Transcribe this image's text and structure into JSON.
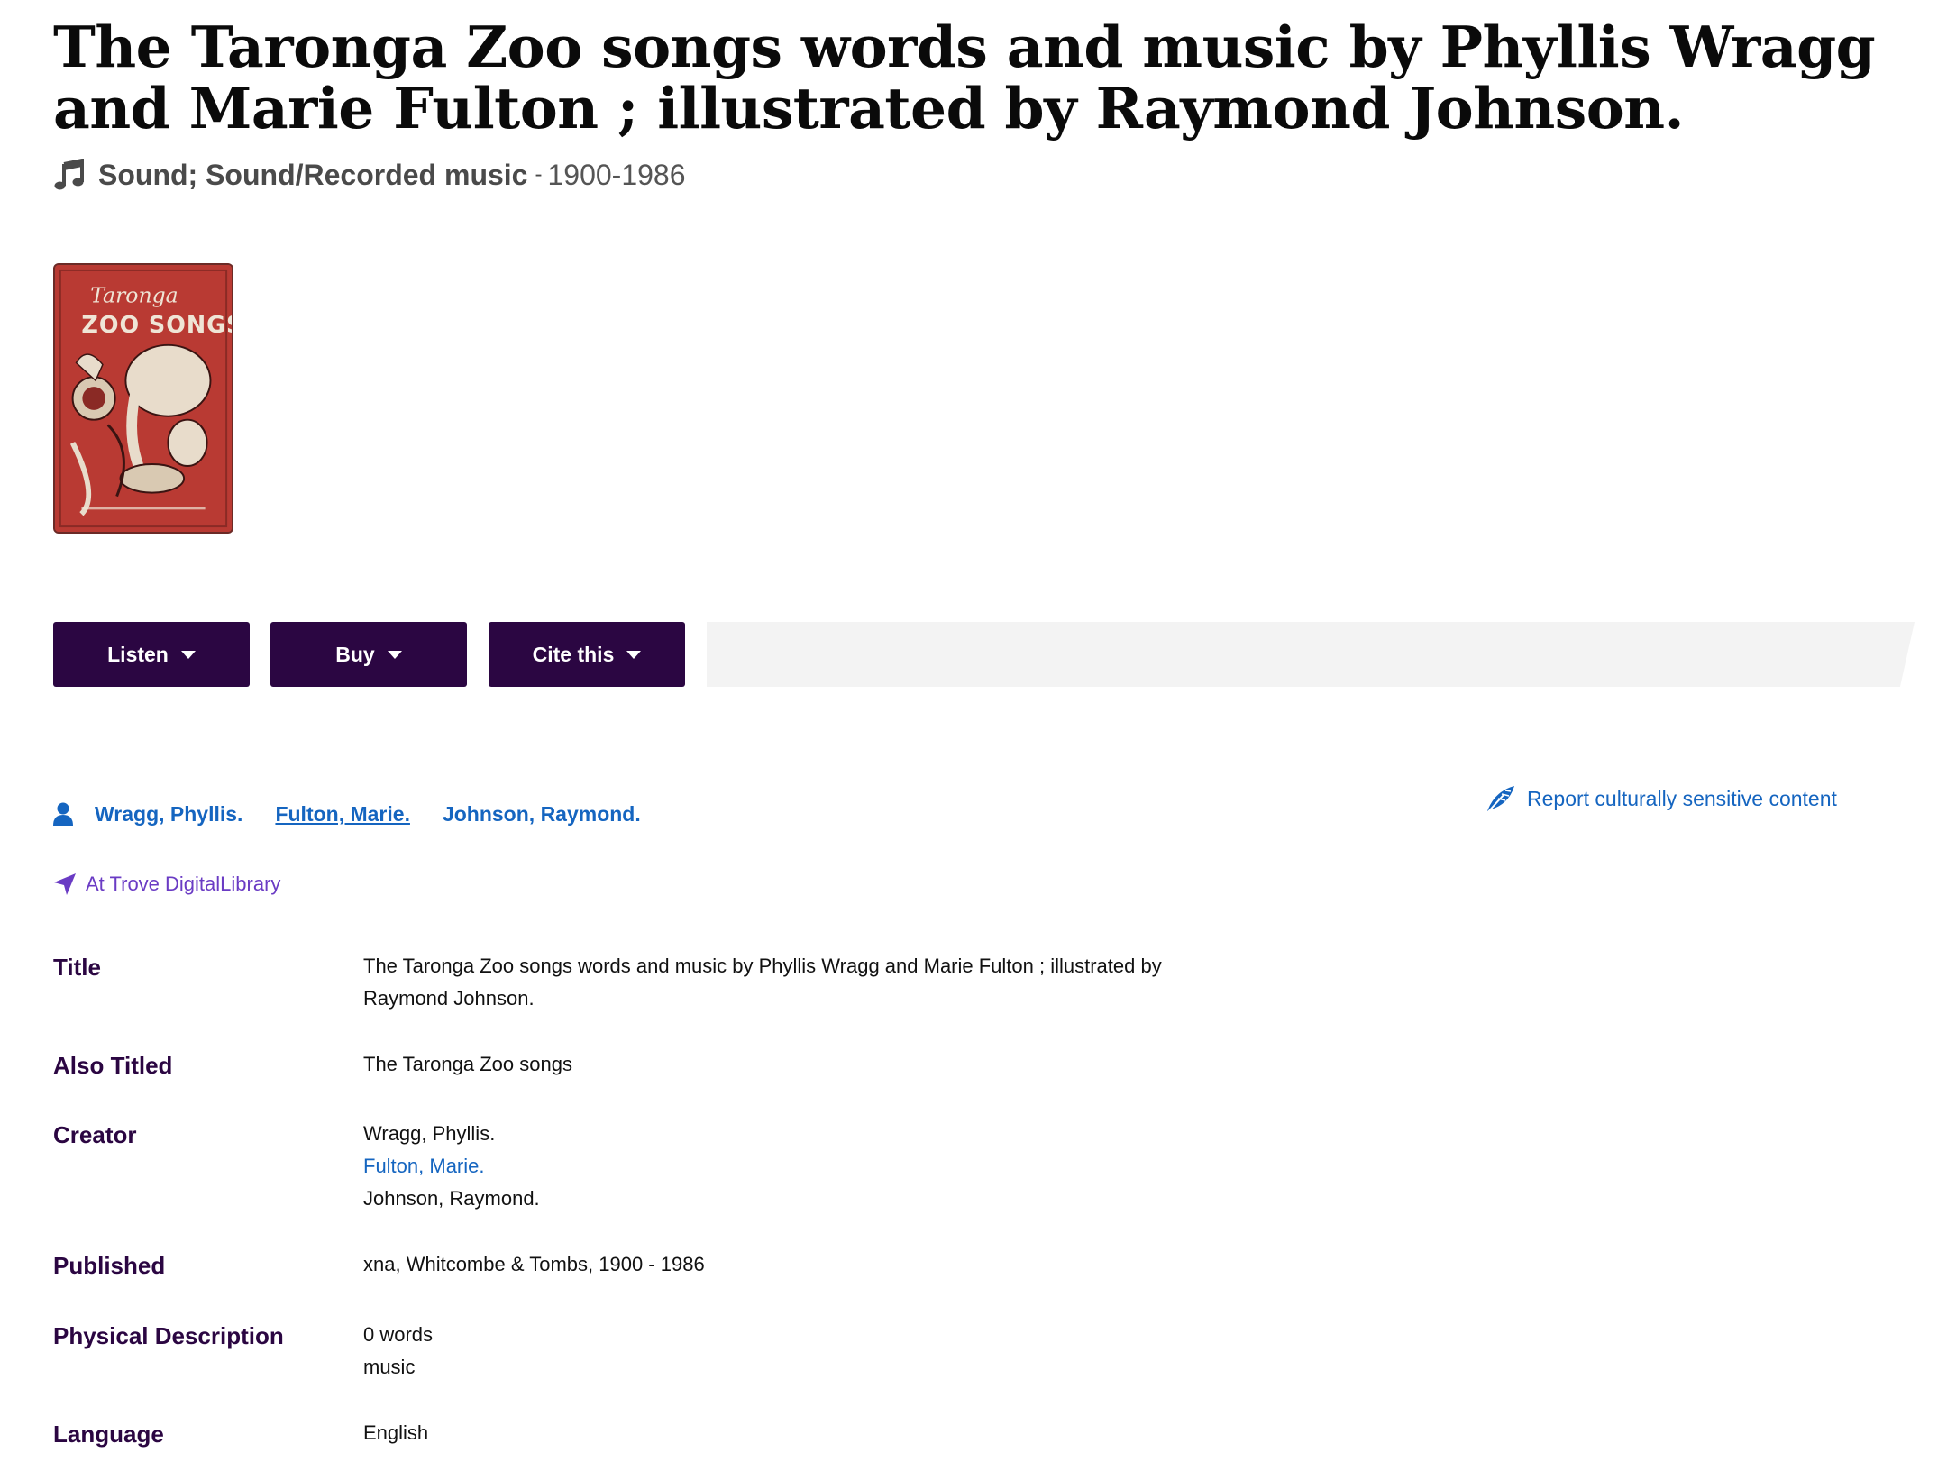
{
  "record": {
    "title": "The Taronga Zoo songs words and music by Phyllis Wragg and Marie Fulton ; illustrated by Raymond Johnson.",
    "format": "Sound; Sound/Recorded music",
    "format_separator": "-",
    "date_range": "1900-1986",
    "format_icon": "music-note-icon"
  },
  "cover": {
    "alt": "Taronga Zoo Songs cover",
    "line1": "Taronga",
    "line2": "ZOO SONGS",
    "colors": {
      "background": "#b93a33",
      "ink": "#efe5d6",
      "shade": "#3a1412"
    }
  },
  "actions": {
    "listen_label": "Listen",
    "buy_label": "Buy",
    "cite_label": "Cite this"
  },
  "contributors": [
    {
      "name": "Wragg, Phyllis."
    },
    {
      "name": "Fulton, Marie."
    },
    {
      "name": "Johnson, Raymond."
    }
  ],
  "report_link": "Report culturally sensitive content",
  "location_link": "At Trove DigitalLibrary",
  "details": {
    "title_label": "Title",
    "title_value": "The Taronga Zoo songs words and music by Phyllis Wragg and Marie Fulton ; illustrated by Raymond Johnson.",
    "also_titled_label": "Also Titled",
    "also_titled_value": "The Taronga Zoo songs",
    "creator_label": "Creator",
    "creators": [
      "Wragg, Phyllis.",
      "Fulton, Marie.",
      "Johnson, Raymond."
    ],
    "published_label": "Published",
    "published_value": "xna, Whitcombe & Tombs, 1900 - 1986",
    "physical_label": "Physical Description",
    "physical_values": [
      "0 words",
      "music"
    ],
    "language_label": "Language",
    "language_value": "English"
  },
  "colors": {
    "button_bg": "#2b0642",
    "link": "#1565c0",
    "label": "#2b0642",
    "location": "#6a3bc4",
    "band": "#f3f3f3"
  }
}
